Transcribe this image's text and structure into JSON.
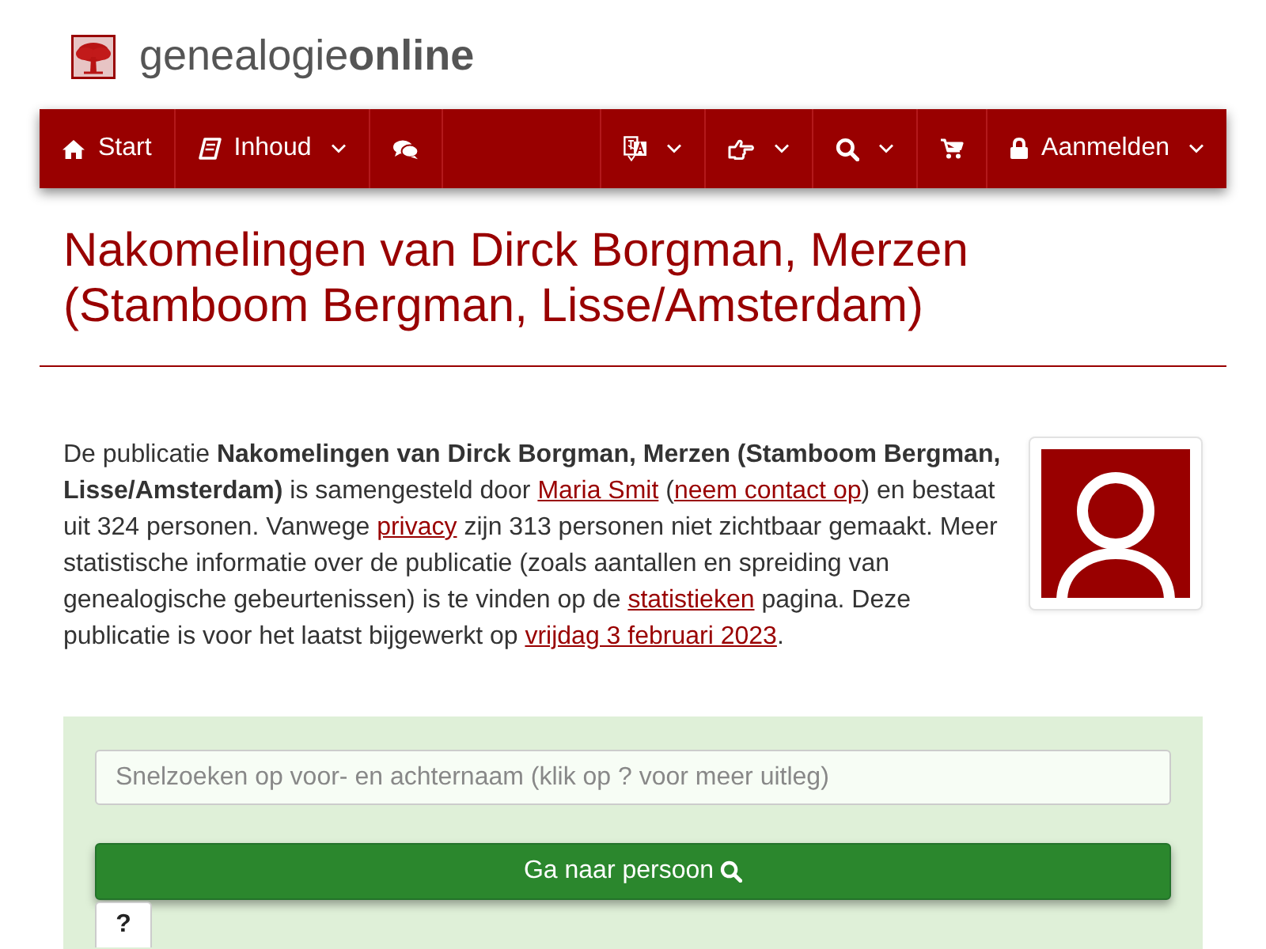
{
  "header": {
    "logo_text": "genealogie**online**"
  },
  "nav": {
    "left": [
      {
        "kind": "home",
        "label": "Start",
        "dropdown": false
      },
      {
        "kind": "contents",
        "label": "Inhoud",
        "dropdown": true
      },
      {
        "kind": "chat",
        "dropdown": false
      }
    ],
    "right": [
      {
        "kind": "language",
        "dropdown": true
      },
      {
        "kind": "tips",
        "dropdown": true
      },
      {
        "kind": "search",
        "dropdown": true
      },
      {
        "kind": "cart",
        "dropdown": false
      },
      {
        "kind": "login",
        "label": "Aanmelden",
        "dropdown": true
      }
    ]
  },
  "title": "Nakomelingen van Dirck Borgman, Merzen (Stamboom Bergman, Lisse/Amsterdam)",
  "description": [
    {
      "kind": "text",
      "text": "De publicatie **Nakomelingen van Dirck Borgman, Merzen (Stamboom Bergman, Lisse/Amsterdam)** is samengesteld door "
    },
    {
      "kind": "link",
      "text": "Maria Smit"
    },
    {
      "kind": "text",
      "text": " ("
    },
    {
      "kind": "link",
      "text": "neem contact op"
    },
    {
      "kind": "text",
      "text": ") en bestaat uit 324 personen. Vanwege "
    },
    {
      "kind": "link",
      "text": "privacy"
    },
    {
      "kind": "text",
      "text": " zijn 313 personen niet zichtbaar gemaakt. Meer statistische informatie over de publicatie (zoals aantallen en spreiding van genealogische gebeurtenissen) is te vinden op de "
    },
    {
      "kind": "link",
      "text": "statistieken"
    },
    {
      "kind": "text",
      "text": " pagina. Deze publicatie is voor het laatst bijgewerkt op "
    },
    {
      "kind": "link",
      "text": "vrijdag 3 februari 2023"
    },
    {
      "kind": "text",
      "text": "."
    }
  ],
  "search": {
    "placeholder": "Snelzoeken op voor- en achternaam (klik op ? voor meer uitleg)",
    "button": "Ga naar persoon",
    "help_button": "?"
  }
}
